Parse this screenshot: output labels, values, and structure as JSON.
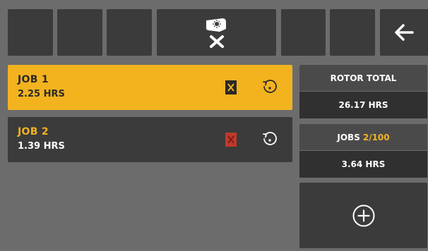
{
  "toolbar": {
    "center_icon": "rotor-reset-icon",
    "back_icon": "arrow-left-icon"
  },
  "jobs": [
    {
      "name": "JOB 1",
      "hours": "2.25 HRS",
      "selected": true
    },
    {
      "name": "JOB 2",
      "hours": "1.39 HRS",
      "selected": false
    }
  ],
  "rotor_total": {
    "label": "ROTOR TOTAL",
    "value": "26.17 HRS"
  },
  "jobs_summary": {
    "label": "JOBS",
    "count": "2/100",
    "value": "3.64 HRS"
  },
  "add_button": {
    "icon": "plus-circle-icon"
  },
  "colors": {
    "accent": "#f2b31f",
    "panel_dark": "#3b3b3b",
    "background": "#6c6c6c",
    "delete_active": "#2a2a2a",
    "delete_disabled": "#c0392b"
  }
}
